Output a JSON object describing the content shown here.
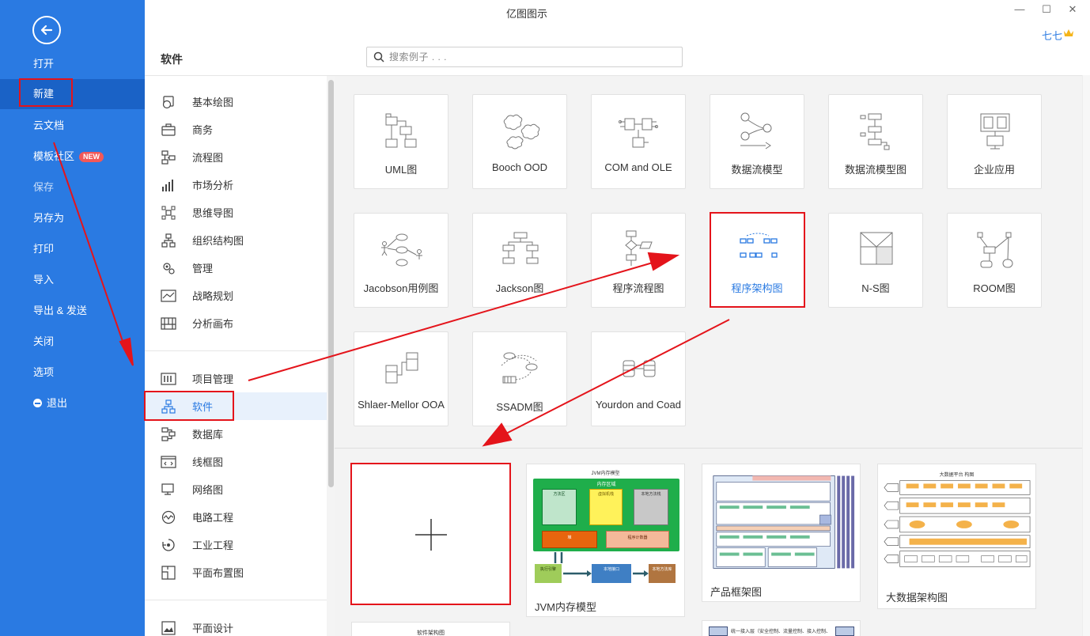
{
  "window": {
    "title": "亿图图示",
    "min": "—",
    "max": "☐",
    "close": "✕",
    "user": "七七"
  },
  "nav": {
    "items": [
      "打开",
      "新建",
      "云文档",
      "模板社区",
      "保存",
      "另存为",
      "打印",
      "导入",
      "导出 & 发送",
      "关闭",
      "选项",
      "退出"
    ],
    "new_badge": "NEW"
  },
  "header": {
    "section_title": "软件"
  },
  "search": {
    "placeholder": "搜索例子 . . ."
  },
  "categories": [
    "基本绘图",
    "商务",
    "流程图",
    "市场分析",
    "思维导图",
    "组织结构图",
    "管理",
    "战略规划",
    "分析画布",
    "项目管理",
    "软件",
    "数据库",
    "线框图",
    "网络图",
    "电路工程",
    "工业工程",
    "平面布置图",
    "平面设计"
  ],
  "tiles": [
    "UML图",
    "Booch OOD",
    "COM and OLE",
    "数据流模型",
    "数据流模型图",
    "企业应用",
    "Jacobson用例图",
    "Jackson图",
    "程序流程图",
    "程序架构图",
    "N-S图",
    "ROOM图",
    "Shlaer-Mellor OOA",
    "SSADM图",
    "Yourdon and Coad"
  ],
  "templates": {
    "jvm": {
      "label": "JVM内存模型",
      "title": "JVM内存模型",
      "region": "内存区域",
      "boxes": [
        "方法区",
        "虚拟机栈",
        "本地方法栈",
        "堆",
        "程序计数器",
        "执行引擎",
        "本地接口",
        "本地方法库"
      ]
    },
    "product": {
      "label": "产品框架图"
    },
    "bigdata": {
      "label": "大数据架构图",
      "title": "大数据平台 构图"
    },
    "partial1": {
      "label": "软件架构图"
    },
    "partial2": {
      "label": "统一接入层（安全控制、流量控制、接入控制、业务隔离）"
    }
  },
  "colors": {
    "nav_blue": "#2a7ae2",
    "highlight_red": "#e4141b",
    "jvm_green": "#1fae4b",
    "jvm_orange": "#e8650e"
  }
}
